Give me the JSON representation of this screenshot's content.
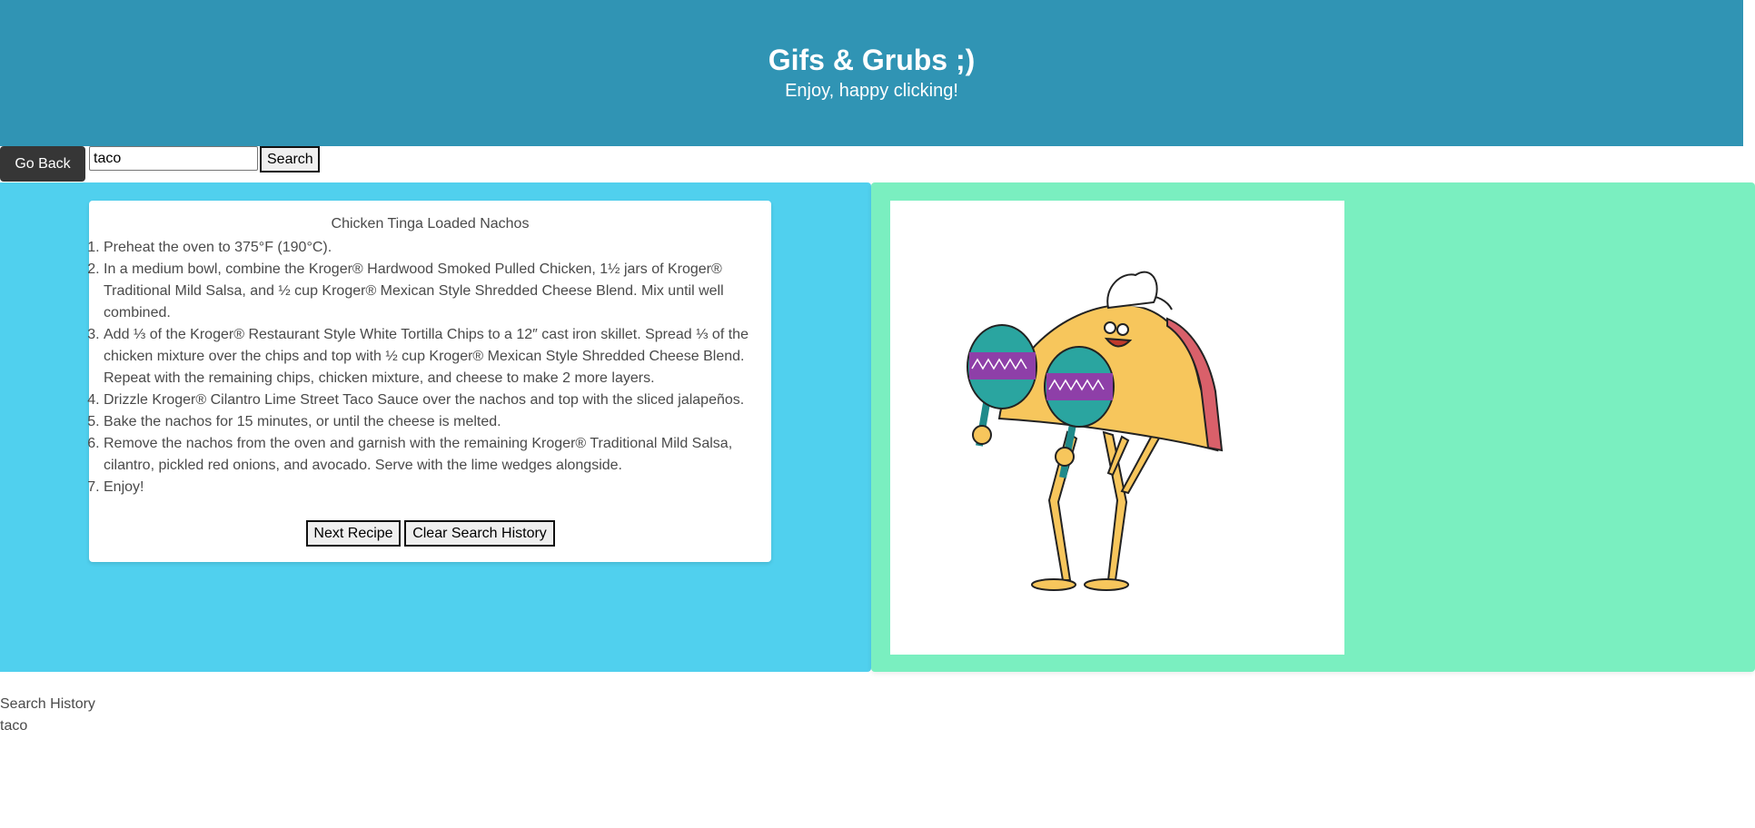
{
  "hero": {
    "title": "Gifs & Grubs ;)",
    "subtitle": "Enjoy, happy clicking!",
    "background": "#3094b4"
  },
  "controls": {
    "go_back_label": "Go Back",
    "search_value": "taco",
    "search_button_label": "Search"
  },
  "recipe": {
    "title": "Chicken Tinga Loaded Nachos",
    "steps": [
      "Preheat the oven to 375°F (190°C).",
      "In a medium bowl, combine the Kroger® Hardwood Smoked Pulled Chicken, 1½ jars of Kroger® Traditional Mild Salsa, and ½ cup Kroger® Mexican Style Shredded Cheese Blend. Mix until well combined.",
      "Add ⅓ of the Kroger® Restaurant Style White Tortilla Chips to a 12″ cast iron skillet. Spread ⅓ of the chicken mixture over the chips and top with ½ cup Kroger® Mexican Style Shredded Cheese Blend. Repeat with the remaining chips, chicken mixture, and cheese to make 2 more layers.",
      "Drizzle Kroger® Cilantro Lime Street Taco Sauce over the nachos and top with the sliced jalapeños.",
      "Bake the nachos for 15 minutes, or until the cheese is melted.",
      "Remove the nachos from the oven and garnish with the remaining Kroger® Traditional Mild Salsa, cilantro, pickled red onions, and avocado. Serve with the lime wedges alongside.",
      "Enjoy!"
    ],
    "next_button_label": "Next Recipe",
    "clear_button_label": "Clear Search History"
  },
  "gif": {
    "icon": "dancing-taco-with-maracas"
  },
  "history": {
    "label": "Search History",
    "items": [
      "taco"
    ]
  },
  "colors": {
    "left_panel": "#50d0ee",
    "right_panel": "#7aefc0",
    "button_dark": "#363636"
  }
}
